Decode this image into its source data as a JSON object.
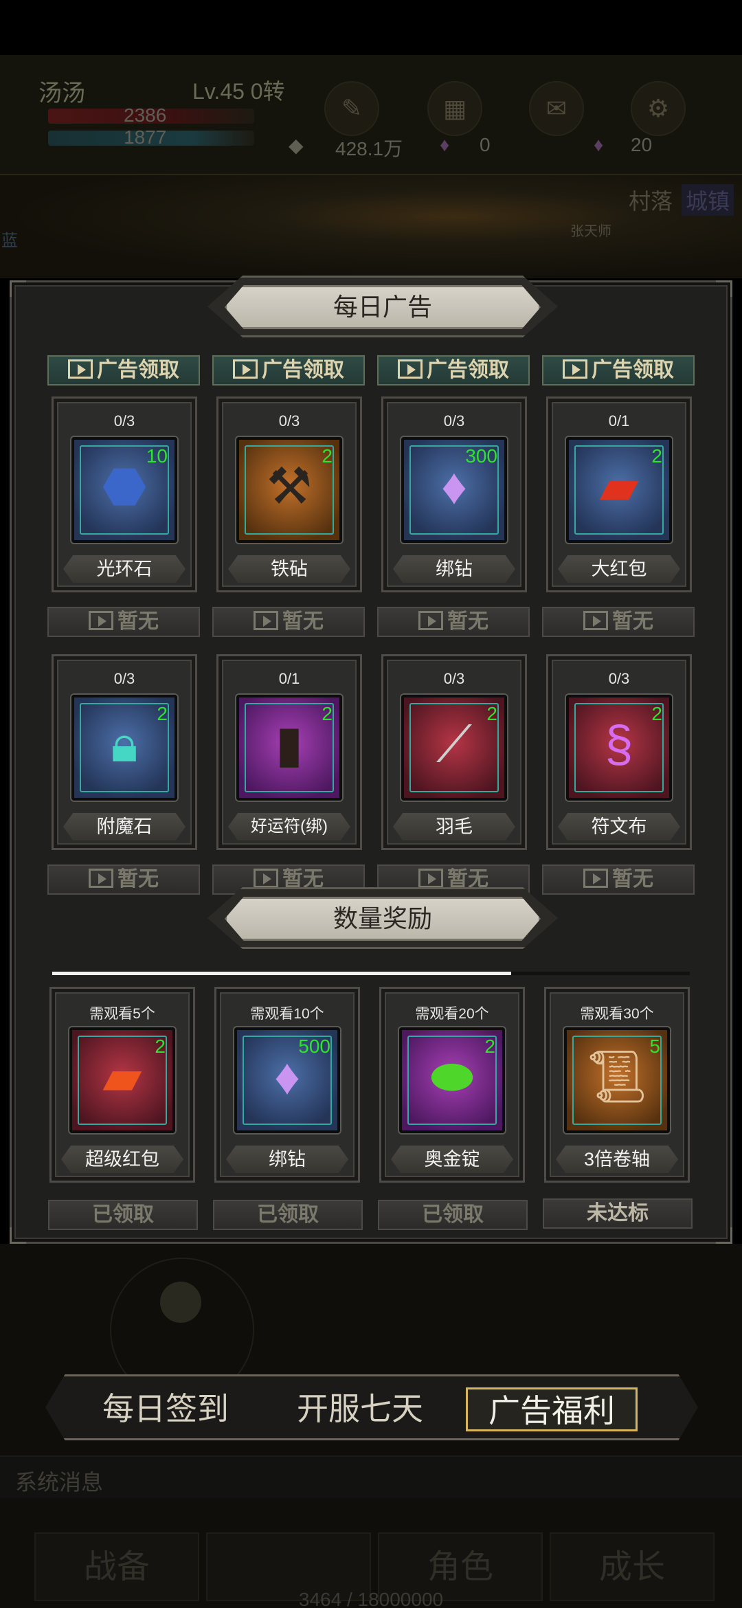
{
  "hud": {
    "player_name": "汤汤",
    "level": "Lv.45 0转",
    "hp": "2386",
    "mp": "1877",
    "gold": "428.1万",
    "gem_a": "0",
    "gem_b": "20",
    "icons": [
      "skill-icon",
      "calendar-icon",
      "mail-icon",
      "settings-icon"
    ]
  },
  "scene": {
    "village": "村落",
    "town": "城镇",
    "npc": "张天师",
    "left_tag": "蓝"
  },
  "dialog": {
    "title": "每日广告",
    "ad_buttons": [
      "广告领取",
      "广告领取",
      "广告领取",
      "广告领取"
    ],
    "row1": [
      {
        "count": "0/3",
        "qty": "10",
        "name": "光环石",
        "icon": "blue-ore-icon",
        "bg": "blue"
      },
      {
        "count": "0/3",
        "qty": "2",
        "name": "铁砧",
        "icon": "anvil-icon",
        "bg": "orange"
      },
      {
        "count": "0/3",
        "qty": "300",
        "name": "绑钻",
        "icon": "bound-diamond-icon",
        "bg": "blue"
      },
      {
        "count": "0/1",
        "qty": "2",
        "name": "大红包",
        "icon": "red-envelope-icon",
        "bg": "blue"
      }
    ],
    "none_label": "暂无",
    "row2": [
      {
        "count": "0/3",
        "qty": "2",
        "name": "附魔石",
        "icon": "enchant-stone-icon",
        "bg": "blue"
      },
      {
        "count": "0/1",
        "qty": "2",
        "name": "好运符(绑)",
        "icon": "luck-charm-icon",
        "bg": "purple"
      },
      {
        "count": "0/3",
        "qty": "2",
        "name": "羽毛",
        "icon": "feather-icon",
        "bg": "red"
      },
      {
        "count": "0/3",
        "qty": "2",
        "name": "符文布",
        "icon": "rune-cloth-icon",
        "bg": "red"
      }
    ],
    "milestone_title": "数量奖励",
    "progress": 0.72,
    "row3": [
      {
        "count": "需观看5个",
        "qty": "2",
        "name": "超级红包",
        "icon": "super-red-envelope-icon",
        "bg": "red",
        "status": "已领取"
      },
      {
        "count": "需观看10个",
        "qty": "500",
        "name": "绑钻",
        "icon": "bound-diamond-icon",
        "bg": "blue",
        "status": "已领取"
      },
      {
        "count": "需观看20个",
        "qty": "2",
        "name": "奥金锭",
        "icon": "gold-ingot-icon",
        "bg": "purple",
        "status": "已领取"
      },
      {
        "count": "需观看30个",
        "qty": "5",
        "name": "3倍卷轴",
        "icon": "scroll-icon",
        "bg": "orange",
        "status": "未达标"
      }
    ]
  },
  "tabs": [
    "每日签到",
    "开服七天",
    "广告福利"
  ],
  "system_message": "系统消息",
  "bottom_nav": [
    "战备",
    "",
    "角色",
    "成长"
  ],
  "exp": "3464 / 18000000"
}
